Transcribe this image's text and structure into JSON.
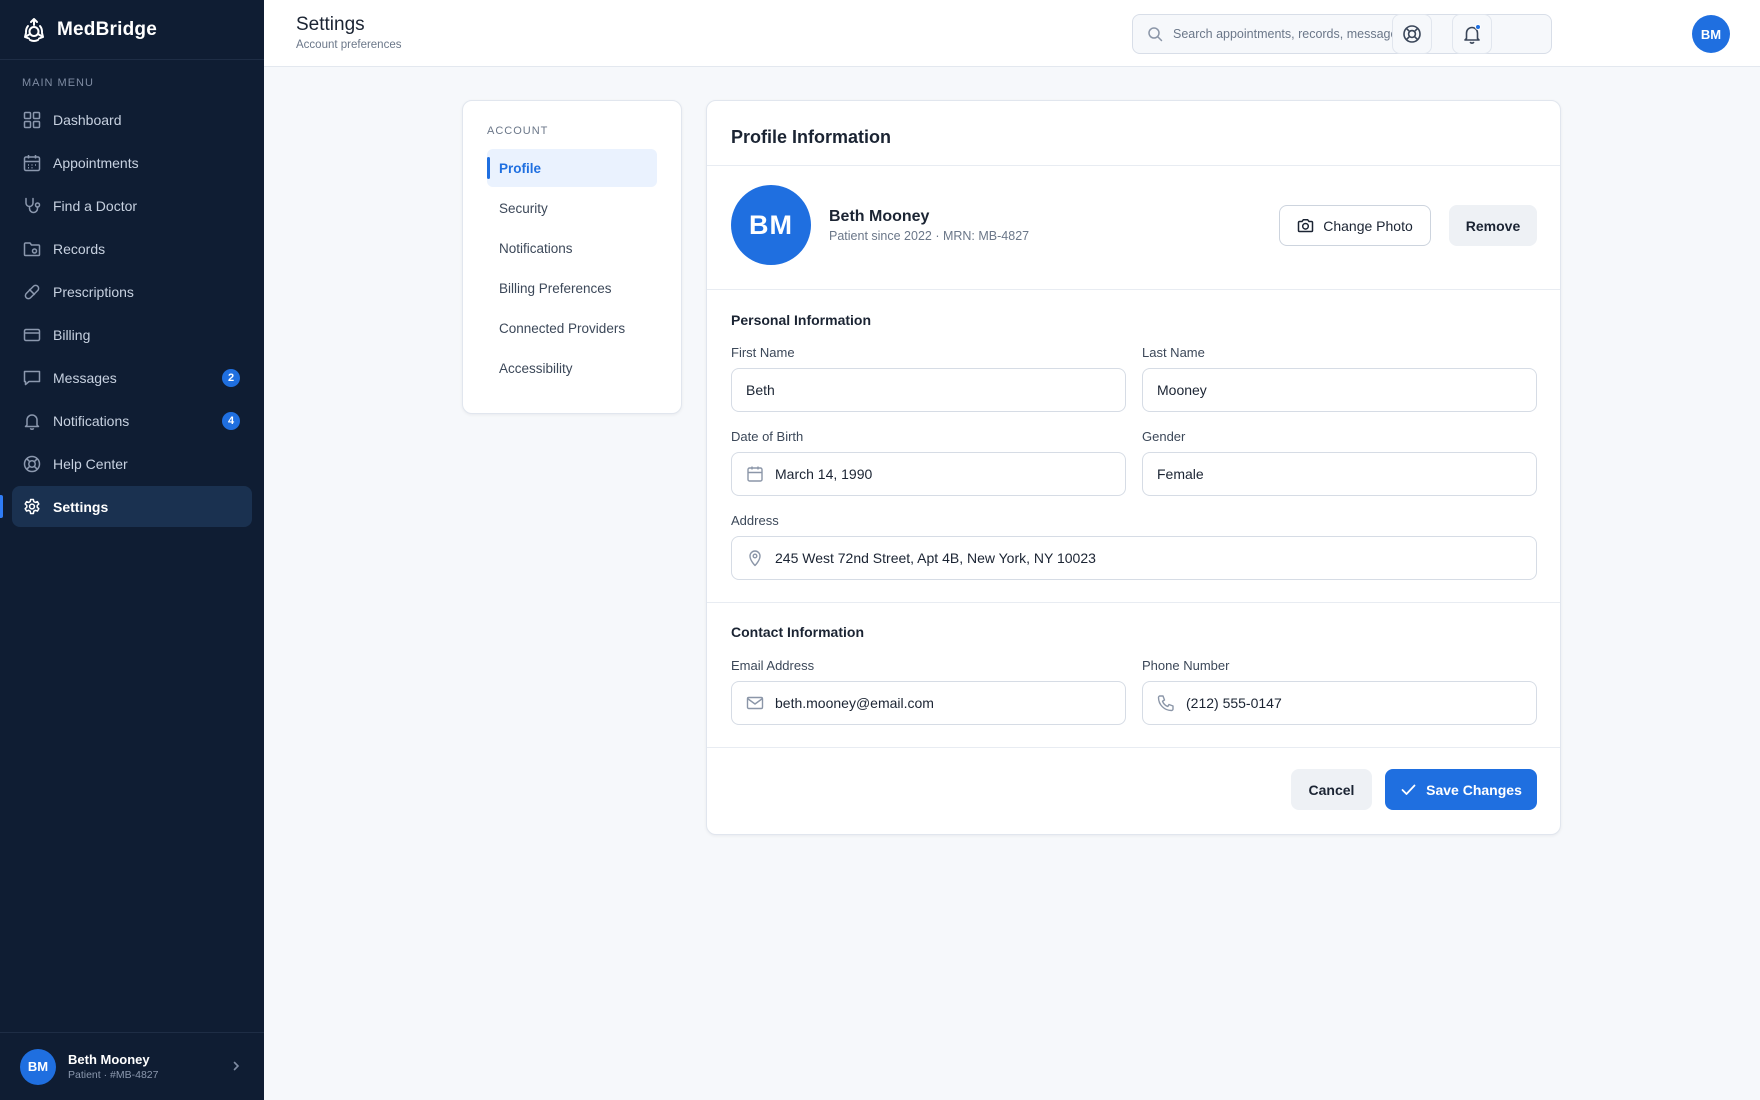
{
  "brand": {
    "name": "MedBridge"
  },
  "sidebar": {
    "heading": "MAIN MENU",
    "items": [
      {
        "label": "Dashboard",
        "icon": "dashboard-icon"
      },
      {
        "label": "Appointments",
        "icon": "calendar-icon"
      },
      {
        "label": "Find a Doctor",
        "icon": "stethoscope-icon"
      },
      {
        "label": "Records",
        "icon": "folder-icon"
      },
      {
        "label": "Prescriptions",
        "icon": "pill-icon"
      },
      {
        "label": "Billing",
        "icon": "credit-card-icon"
      },
      {
        "label": "Messages",
        "icon": "message-icon",
        "badge": "2"
      },
      {
        "label": "Notifications",
        "icon": "bell-icon",
        "badge": "4"
      },
      {
        "label": "Help Center",
        "icon": "lifebuoy-icon"
      },
      {
        "label": "Settings",
        "icon": "gear-icon",
        "active": true
      }
    ],
    "user": {
      "initials": "BM",
      "name": "Beth Mooney",
      "sub": "Patient · #MB-4827"
    }
  },
  "header": {
    "title": "Settings",
    "subtitle": "Account preferences",
    "search_placeholder": "Search appointments, records, messages...",
    "avatar_initials": "BM"
  },
  "settings_nav": {
    "heading": "ACCOUNT",
    "items": [
      {
        "label": "Profile",
        "active": true
      },
      {
        "label": "Security"
      },
      {
        "label": "Notifications"
      },
      {
        "label": "Billing Preferences"
      },
      {
        "label": "Connected Providers"
      },
      {
        "label": "Accessibility"
      }
    ]
  },
  "profile": {
    "title": "Profile Information",
    "initials": "BM",
    "name": "Beth Mooney",
    "meta": "Patient since 2022 · MRN: MB-4827",
    "change_photo_label": "Change Photo",
    "remove_label": "Remove",
    "personal_title": "Personal Information",
    "first_name_label": "First Name",
    "first_name": "Beth",
    "last_name_label": "Last Name",
    "last_name": "Mooney",
    "dob_label": "Date of Birth",
    "dob": "March 14, 1990",
    "gender_label": "Gender",
    "gender": "Female",
    "address_label": "Address",
    "address": "245 West 72nd Street, Apt 4B, New York, NY 10023",
    "contact_title": "Contact Information",
    "email_label": "Email Address",
    "email": "beth.mooney@email.com",
    "phone_label": "Phone Number",
    "phone": "(212) 555-0147",
    "cancel_label": "Cancel",
    "save_label": "Save Changes"
  },
  "colors": {
    "sidebar_bg": "#0f1d33",
    "accent": "#1f6fe0",
    "page_bg": "#f6f8fb"
  }
}
